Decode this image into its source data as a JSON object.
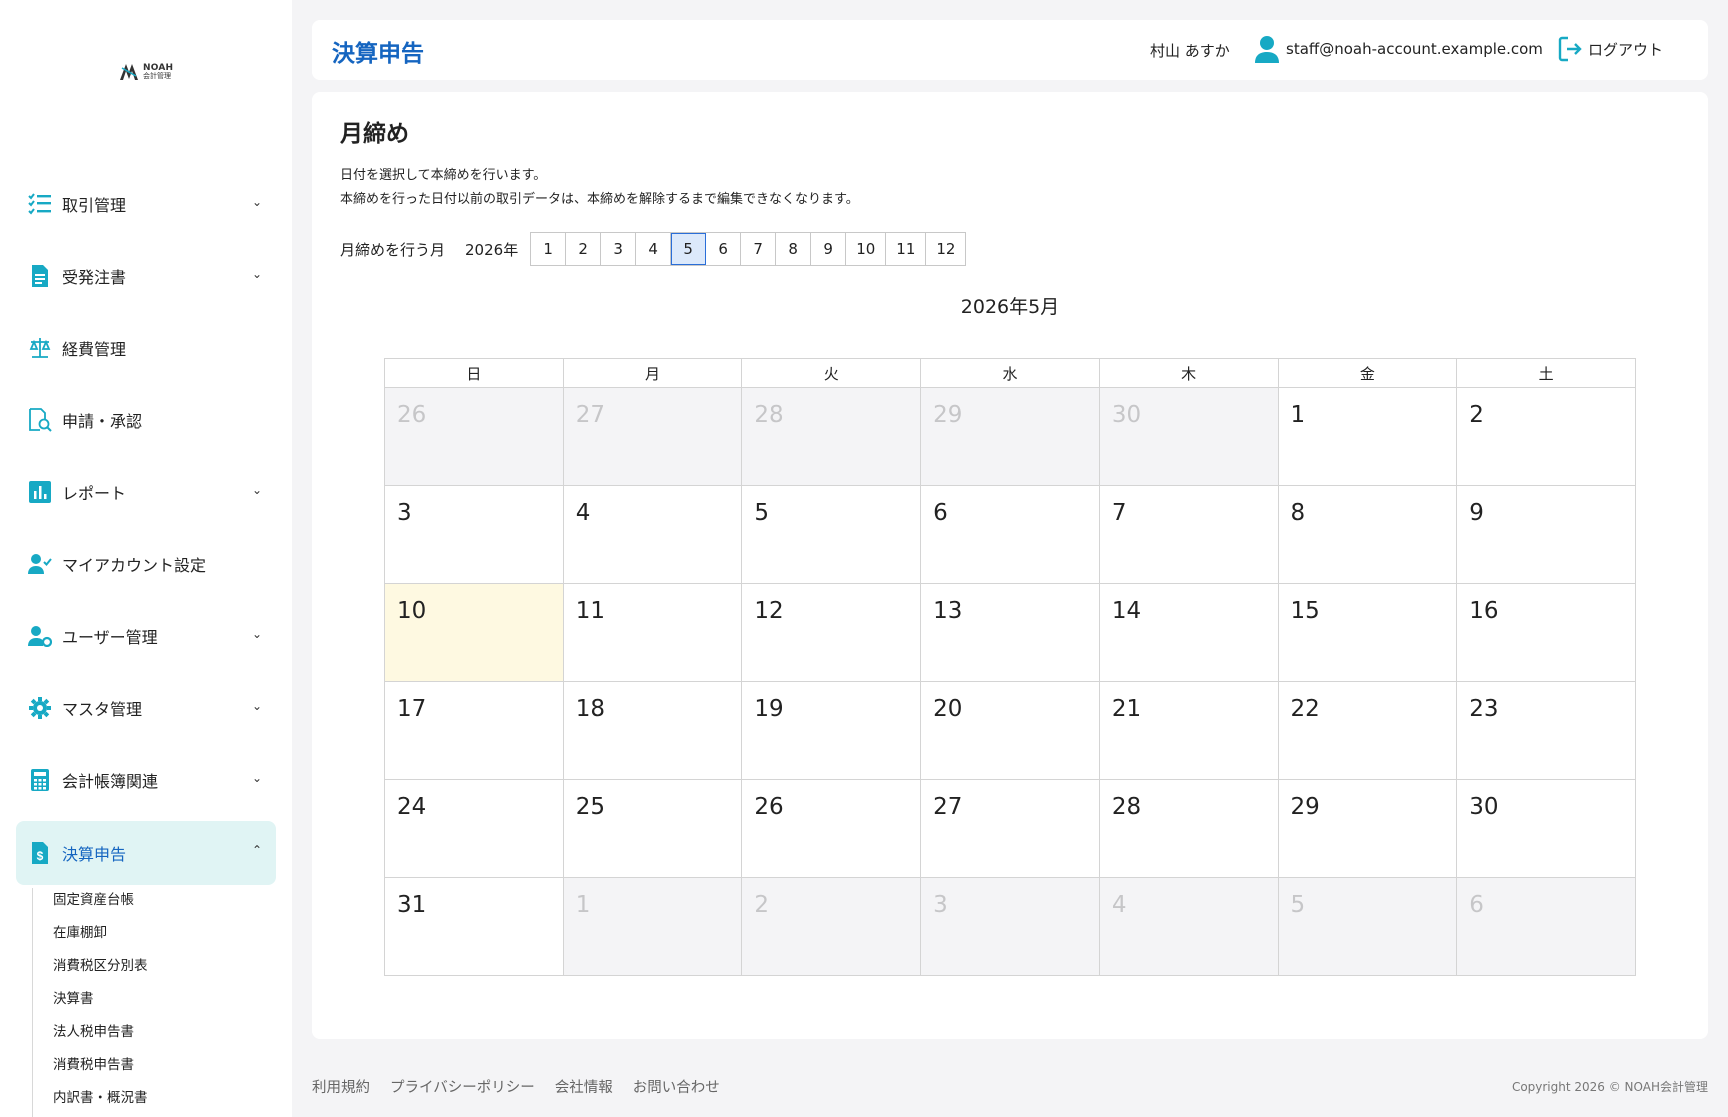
{
  "brand": {
    "name": "NOAH",
    "sub": "会計管理"
  },
  "sidebar": {
    "items": [
      {
        "label": "取引管理",
        "chevron": "down",
        "icon": "checklist-icon"
      },
      {
        "label": "受発注書",
        "chevron": "down",
        "icon": "document-icon"
      },
      {
        "label": "経費管理",
        "chevron": "",
        "icon": "scale-icon"
      },
      {
        "label": "申請・承認",
        "chevron": "",
        "icon": "document-search-icon"
      },
      {
        "label": "レポート",
        "chevron": "down",
        "icon": "bar-chart-icon"
      },
      {
        "label": "マイアカウント設定",
        "chevron": "",
        "icon": "user-check-icon"
      },
      {
        "label": "ユーザー管理",
        "chevron": "down",
        "icon": "user-gear-icon"
      },
      {
        "label": "マスタ管理",
        "chevron": "down",
        "icon": "gear-icon"
      },
      {
        "label": "会計帳簿関連",
        "chevron": "down",
        "icon": "calculator-icon"
      },
      {
        "label": "決算申告",
        "chevron": "up",
        "icon": "dollar-document-icon",
        "active": true
      }
    ],
    "sub_items": [
      "固定資産台帳",
      "在庫棚卸",
      "消費税区分別表",
      "決算書",
      "法人税申告書",
      "消費税申告書",
      "内訳書・概況書"
    ]
  },
  "header": {
    "title": "決算申告",
    "user_name": "村山 あすか",
    "user_email": "staff@noah-account.example.com",
    "logout_label": "ログアウト"
  },
  "main": {
    "title": "月締め",
    "desc_line1": "日付を選択して本締めを行います。",
    "desc_line2": "本締めを行った日付以前の取引データは、本締めを解除するまで編集できなくなります。",
    "month_label": "月締めを行う月",
    "year_label": "2026年",
    "months": [
      "1",
      "2",
      "3",
      "4",
      "5",
      "6",
      "7",
      "8",
      "9",
      "10",
      "11",
      "12"
    ],
    "selected_month": "5",
    "calendar_title": "2026年5月",
    "weekdays": [
      "日",
      "月",
      "火",
      "水",
      "木",
      "金",
      "土"
    ],
    "weeks": [
      [
        {
          "d": "26",
          "out": true
        },
        {
          "d": "27",
          "out": true
        },
        {
          "d": "28",
          "out": true
        },
        {
          "d": "29",
          "out": true
        },
        {
          "d": "30",
          "out": true
        },
        {
          "d": "1"
        },
        {
          "d": "2"
        }
      ],
      [
        {
          "d": "3"
        },
        {
          "d": "4"
        },
        {
          "d": "5"
        },
        {
          "d": "6"
        },
        {
          "d": "7"
        },
        {
          "d": "8"
        },
        {
          "d": "9"
        }
      ],
      [
        {
          "d": "10",
          "today": true
        },
        {
          "d": "11"
        },
        {
          "d": "12"
        },
        {
          "d": "13"
        },
        {
          "d": "14"
        },
        {
          "d": "15"
        },
        {
          "d": "16"
        }
      ],
      [
        {
          "d": "17"
        },
        {
          "d": "18"
        },
        {
          "d": "19"
        },
        {
          "d": "20"
        },
        {
          "d": "21"
        },
        {
          "d": "22"
        },
        {
          "d": "23"
        }
      ],
      [
        {
          "d": "24"
        },
        {
          "d": "25"
        },
        {
          "d": "26"
        },
        {
          "d": "27"
        },
        {
          "d": "28"
        },
        {
          "d": "29"
        },
        {
          "d": "30"
        }
      ],
      [
        {
          "d": "31"
        },
        {
          "d": "1",
          "out": true
        },
        {
          "d": "2",
          "out": true
        },
        {
          "d": "3",
          "out": true
        },
        {
          "d": "4",
          "out": true
        },
        {
          "d": "5",
          "out": true
        },
        {
          "d": "6",
          "out": true
        }
      ]
    ]
  },
  "footer": {
    "links": [
      "利用規約",
      "プライバシーポリシー",
      "会社情報",
      "お問い合わせ"
    ],
    "copyright": "Copyright 2026 © NOAH会計管理"
  },
  "colors": {
    "accent": "#1565c0",
    "icon": "#17a9c4",
    "active_bg": "#e0f4f4",
    "today_bg": "#fef9e1",
    "selected_month_bg": "#dce9fb"
  }
}
